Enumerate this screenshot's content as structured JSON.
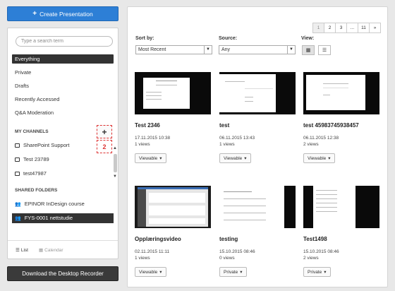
{
  "sidebar": {
    "create_label": "Create Presentation",
    "search_placeholder": "Type a search term",
    "nav": [
      "Everything",
      "Private",
      "Drafts",
      "Recently Accessed",
      "Q&A Moderation"
    ],
    "my_channels_label": "MY CHANNELS",
    "channels": [
      "SharePoint Support",
      "Test 23789",
      "test47987"
    ],
    "add_badge": "2",
    "shared_folders_label": "SHARED FOLDERS",
    "folders": [
      "EPINOR InDesign course",
      "FYS-0001 nettstudie"
    ],
    "footer": {
      "list_label": "List",
      "calendar_label": "Calendar"
    },
    "desktop_label": "Download the Desktop Recorder"
  },
  "pager": [
    "1",
    "2",
    "3",
    "...",
    "11",
    "»"
  ],
  "filters": {
    "sort_label": "Sort by:",
    "sort_value": "Most Recent",
    "source_label": "Source:",
    "source_value": "Any",
    "view_label": "View:"
  },
  "cards": [
    {
      "title": "Test 2346",
      "date": "17.11.2015 10:38",
      "views": "1 views",
      "button": "Viewable"
    },
    {
      "title": "test",
      "date": "06.11.2015 13:43",
      "views": "1 views",
      "button": "Viewable"
    },
    {
      "title": "test 45983745938457",
      "date": "06.11.2015 12:38",
      "views": "2 views",
      "button": "Viewable"
    },
    {
      "title": "Opplæringsvideo",
      "date": "02.11.2015 11:11",
      "views": "1 views",
      "button": "Viewable"
    },
    {
      "title": "testing",
      "date": "15.10.2015 08:46",
      "views": "0 views",
      "button": "Private"
    },
    {
      "title": "Test1498",
      "date": "15.10.2015 08:46",
      "views": "2 views",
      "button": "Private"
    }
  ],
  "colors": {
    "primary": "#2d7fd6",
    "dark": "#333333",
    "highlight": "#dd3333"
  }
}
